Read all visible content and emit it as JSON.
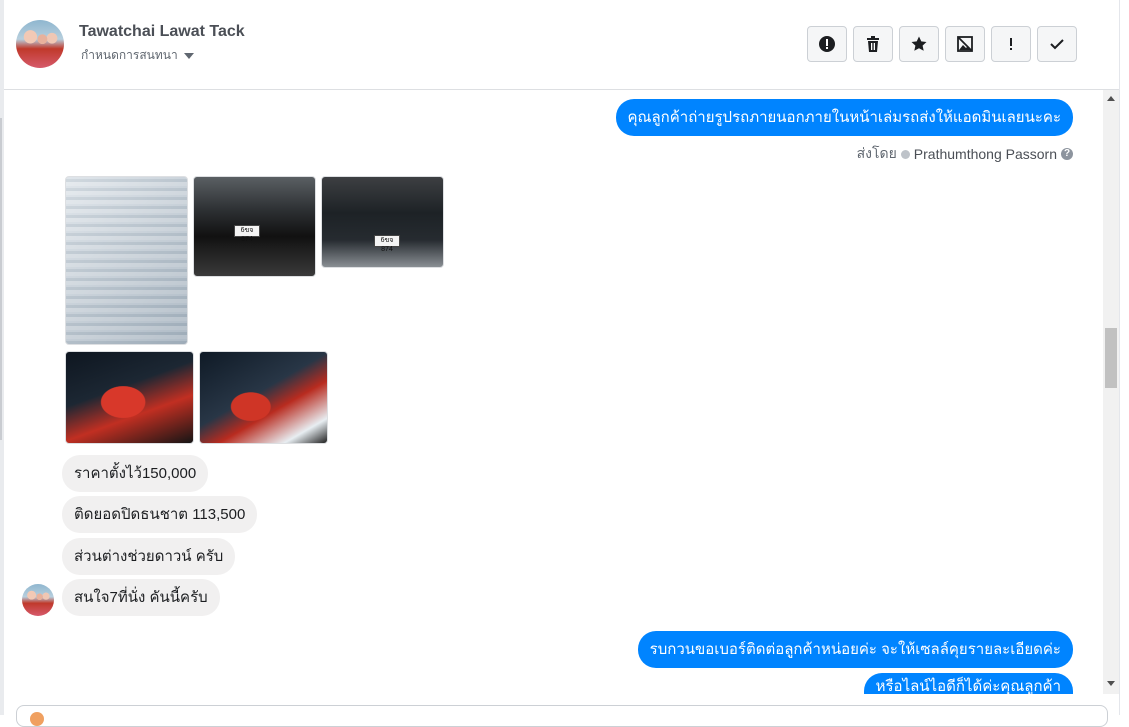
{
  "header": {
    "contact_name": "Tawatchai Lawat Tack",
    "subtitle": "กำหนดการสนทนา",
    "actions": [
      {
        "name": "report-spam-icon",
        "label": "Mark as spam"
      },
      {
        "name": "trash-icon",
        "label": "Delete"
      },
      {
        "name": "star-icon",
        "label": "Star"
      },
      {
        "name": "image-off-icon",
        "label": "Images"
      },
      {
        "name": "exclamation-icon",
        "label": "Important"
      },
      {
        "name": "check-icon",
        "label": "Done"
      }
    ]
  },
  "messages": {
    "out_1": "คุณลูกค้าถ่ายรูปรถภายนอกภายในหน้าเล่มรถส่งให้แอดมินเลยนะคะ",
    "sent_by_prefix": "ส่งโดย",
    "sent_by_name": "Prathumthong Passorn",
    "help": "?",
    "in_1": "ราคาตั้งไว้150,000",
    "in_2": "ติดยอดปิดธนชาต 113,500",
    "in_3": "ส่วนต่างช่วยดาวน์ ครับ",
    "in_4": "สนใจ7ที่นั่ง คันนี้ครับ",
    "out_2": "รบกวนขอเบอร์ติดต่อลูกค้าหน่อยค่ะ จะให้เซลล์คุยรายละเอียดค่ะ",
    "out_3": "หรือไลน์ไอดีก็ได้ค่ะคุณลูกค้า"
  },
  "photos": [
    {
      "name": "photo-registration-book",
      "desc": "registration document"
    },
    {
      "name": "photo-car-rear",
      "plate": "6ขจ 874"
    },
    {
      "name": "photo-car-front",
      "plate": "6ขจ 874"
    },
    {
      "name": "photo-interior-front",
      "desc": "red leather interior"
    },
    {
      "name": "photo-interior-side",
      "desc": "red leather interior"
    }
  ],
  "colors": {
    "accent": "#0084ff",
    "incoming_bubble": "#f1f0f0"
  }
}
